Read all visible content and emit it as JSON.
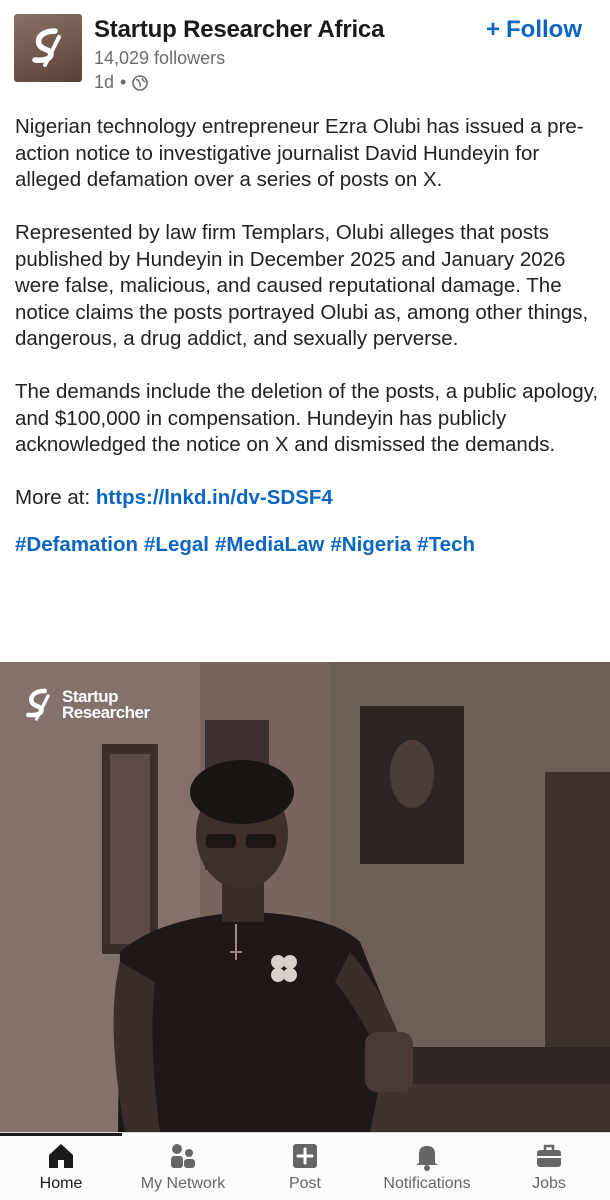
{
  "post": {
    "author": "Startup Researcher Africa",
    "followers": "14,029 followers",
    "age": "1d",
    "follow_label": "Follow",
    "paragraphs": [
      "Nigerian technology entrepreneur Ezra Olubi has issued a pre-action notice to investigative journalist David Hundeyin for alleged defamation over a series of posts on X.",
      "Represented by law firm Templars, Olubi alleges that posts published by Hundeyin in December 2025 and January 2026 were false, malicious, and caused reputational damage. The notice claims the posts portrayed Olubi as, among other things, dangerous, a drug addict, and sexually perverse.",
      "The demands include the deletion of the posts, a public apology, and $100,000 in compensation. Hundeyin has publicly acknowledged the notice on X and dismissed the demands."
    ],
    "more_prefix": "More at:",
    "more_link": "https://lnkd.in/dv-SDSF4",
    "hashtags": [
      "#Defamation",
      "#Legal",
      "#MediaLaw",
      "#Nigeria",
      "#Tech"
    ],
    "image_watermark": [
      "Startup",
      "Researcher"
    ]
  },
  "nav": {
    "items": [
      {
        "label": "Home",
        "icon": "home-icon"
      },
      {
        "label": "My Network",
        "icon": "network-icon"
      },
      {
        "label": "Post",
        "icon": "post-icon"
      },
      {
        "label": "Notifications",
        "icon": "bell-icon"
      },
      {
        "label": "Jobs",
        "icon": "briefcase-icon"
      }
    ]
  },
  "colors": {
    "accent": "#0a66c2",
    "text": "#222222",
    "muted": "#6b6b6b"
  }
}
